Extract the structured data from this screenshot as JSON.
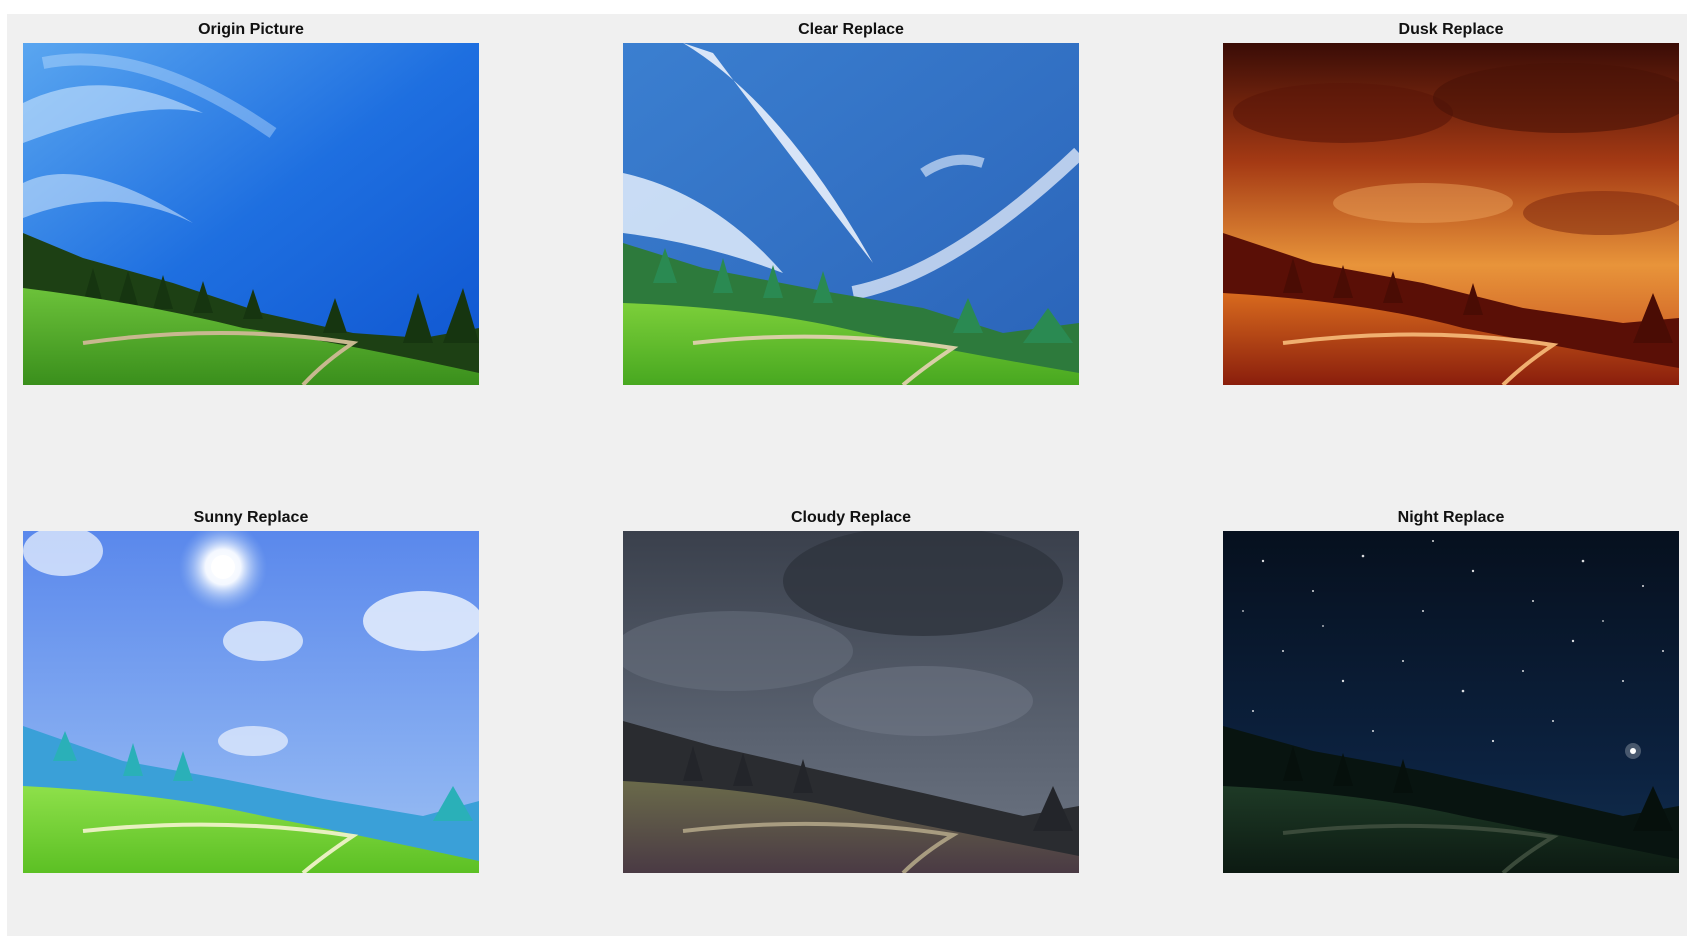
{
  "figure": {
    "panels": [
      {
        "title": "Origin Picture",
        "icon": "landscape-blue-sky"
      },
      {
        "title": "Clear Replace",
        "icon": "landscape-clear-sky"
      },
      {
        "title": "Dusk Replace",
        "icon": "landscape-dusk-sky"
      },
      {
        "title": "Sunny Replace",
        "icon": "landscape-sunny-sky"
      },
      {
        "title": "Cloudy Replace",
        "icon": "landscape-cloudy-sky"
      },
      {
        "title": "Night Replace",
        "icon": "landscape-night-sky"
      }
    ],
    "colors": {
      "background": "#f0f0f0",
      "origin_sky": "#1e6fe0",
      "dusk_sky": "#b33a12",
      "night_sky": "#0a1a30",
      "cloudy_sky": "#4e5664",
      "grass": "#4fb02a"
    }
  }
}
